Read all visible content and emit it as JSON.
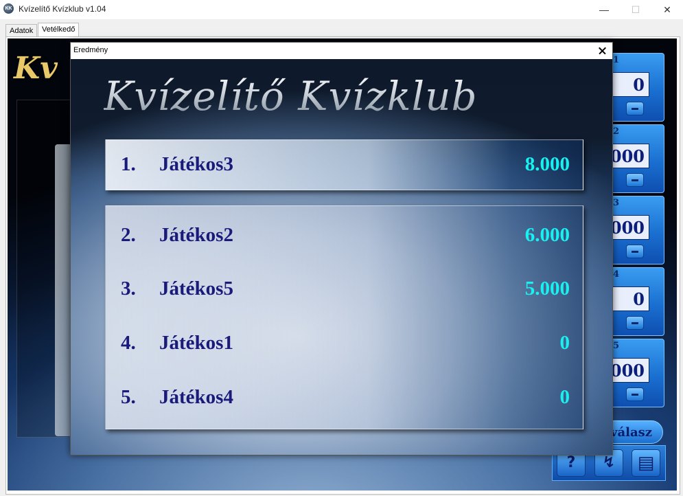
{
  "window": {
    "title": "Kvízelítő Kvízklub v1.04",
    "icon_text": "KK"
  },
  "tabs": [
    {
      "label": "Adatok",
      "active": false
    },
    {
      "label": "Vetélkedő",
      "active": true
    }
  ],
  "background": {
    "logo_fragment": "Kv",
    "players": [
      {
        "num": "1",
        "score": "0"
      },
      {
        "num": "2",
        "score": "000"
      },
      {
        "num": "3",
        "score": "000"
      },
      {
        "num": "4",
        "score": "0"
      },
      {
        "num": "5",
        "score": "000"
      }
    ],
    "answer_label": "válasz",
    "tools": [
      {
        "label": "?",
        "icon": "help-icon"
      },
      {
        "label": "↯",
        "icon": "lightning-icon"
      },
      {
        "label": "▤",
        "icon": "list-icon"
      }
    ]
  },
  "dialog": {
    "title": "Eredmény",
    "logo": "Kvízelítő Kvízklub",
    "results": [
      {
        "rank": "1.",
        "name": "Játékos3",
        "score": "8.000"
      },
      {
        "rank": "2.",
        "name": "Játékos2",
        "score": "6.000"
      },
      {
        "rank": "3.",
        "name": "Játékos5",
        "score": "5.000"
      },
      {
        "rank": "4.",
        "name": "Játékos1",
        "score": "0"
      },
      {
        "rank": "5.",
        "name": "Játékos4",
        "score": "0"
      }
    ]
  },
  "colors": {
    "rank_name": "#1a1a7a",
    "score": "#19f0f0",
    "player_card": "#1a6fd0"
  }
}
